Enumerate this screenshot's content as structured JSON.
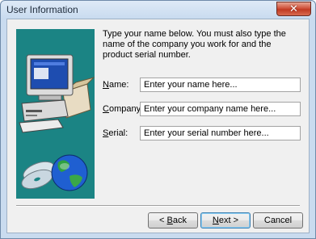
{
  "window": {
    "title": "User Information",
    "close_glyph": "✕"
  },
  "intro_text": "Type your name below. You must also type the name of the company you work for and the product serial number.",
  "fields": [
    {
      "label_pre": "",
      "label_key": "N",
      "label_post": "ame:",
      "placeholder": "Enter your name here..."
    },
    {
      "label_pre": "",
      "label_key": "C",
      "label_post": "ompany:",
      "placeholder": "Enter your company name here..."
    },
    {
      "label_pre": "",
      "label_key": "S",
      "label_post": "erial:",
      "placeholder": "Enter your serial number here..."
    }
  ],
  "buttons": {
    "back": {
      "arrow": "<",
      "key": "B",
      "rest": "ack"
    },
    "next": {
      "key": "N",
      "rest": "ext",
      "arrow": ">"
    },
    "cancel": "Cancel"
  },
  "colors": {
    "side_panel": "#1b8484",
    "close_button": "#c13a22",
    "default_button_border": "#3c7fb1"
  },
  "icons": [
    "close-icon",
    "computer-illustration",
    "cd-discs-illustration",
    "globe-illustration"
  ]
}
